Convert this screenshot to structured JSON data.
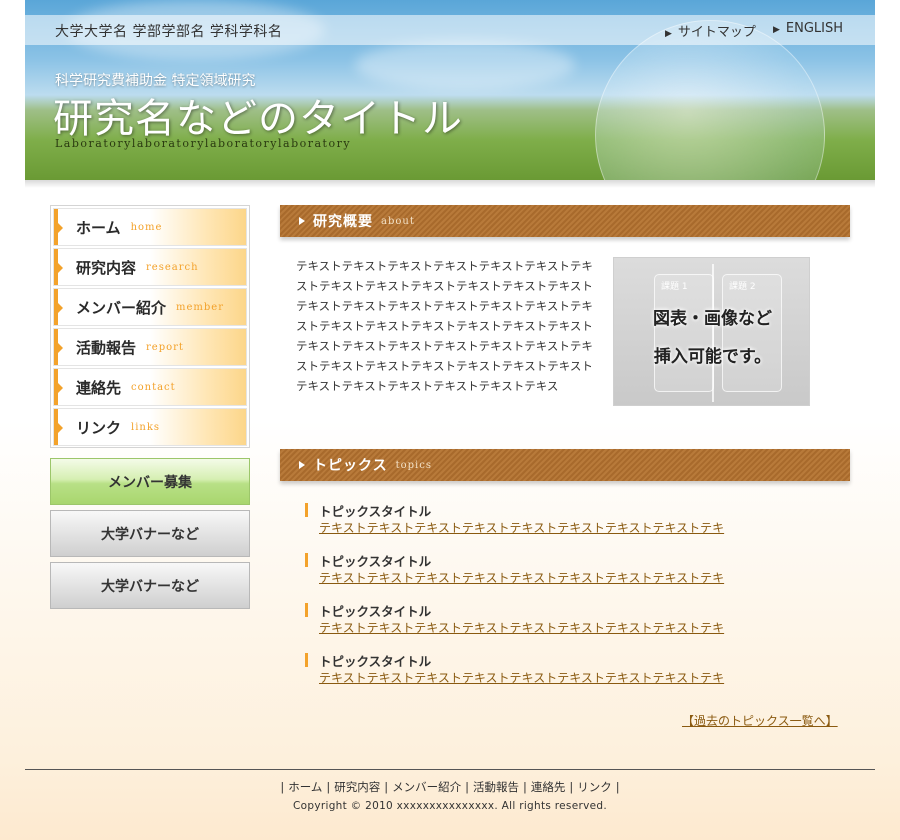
{
  "header": {
    "university": "大学大学名 学部学部名 学科学科名",
    "nav": [
      {
        "label": "サイトマップ"
      },
      {
        "label": "ENGLISH"
      }
    ],
    "subtitle": "科学研究費補助金 特定領域研究",
    "title": "研究名などのタイトル",
    "lab": "Laboratorylaboratorylaboratorylaboratory"
  },
  "sidebar": {
    "items": [
      {
        "jp": "ホーム",
        "en": "home"
      },
      {
        "jp": "研究内容",
        "en": "research"
      },
      {
        "jp": "メンバー紹介",
        "en": "member"
      },
      {
        "jp": "活動報告",
        "en": "report"
      },
      {
        "jp": "連絡先",
        "en": "contact"
      },
      {
        "jp": "リンク",
        "en": "links"
      }
    ],
    "banners": {
      "members": "メンバー募集",
      "univ1": "大学バナーなど",
      "univ2": "大学バナーなど"
    }
  },
  "about": {
    "heading_jp": "研究概要",
    "heading_en": "about",
    "text": "テキストテキストテキストテキストテキストテキストテキストテキストテキストテキストテキストテキストテキストテキストテキストテキストテキストテキストテキストテキストテキストテキストテキストテキストテキストテキストテキストテキストテキストテキストテキストテキストテキストテキストテキストテキストテキストテキストテキストテキストテキストテキストテキストテキストテキス",
    "figure": {
      "box1": "課題 1",
      "box2": "課題 2",
      "caption_line1": "図表・画像など",
      "caption_line2": "挿入可能です。"
    }
  },
  "topics": {
    "heading_jp": "トピックス",
    "heading_en": "topics",
    "items": [
      {
        "title": "トピックスタイトル",
        "link": "テキストテキストテキストテキストテキストテキストテキストテキストテキ"
      },
      {
        "title": "トピックスタイトル",
        "link": "テキストテキストテキストテキストテキストテキストテキストテキストテキ"
      },
      {
        "title": "トピックスタイトル",
        "link": "テキストテキストテキストテキストテキストテキストテキストテキストテキ"
      },
      {
        "title": "トピックスタイトル",
        "link": "テキストテキストテキストテキストテキストテキストテキストテキストテキ"
      }
    ],
    "past_link": "【過去のトピックス一覧へ】"
  },
  "footer": {
    "nav": [
      "ホーム",
      "研究内容",
      "メンバー紹介",
      "活動報告",
      "連絡先",
      "リンク"
    ],
    "copyright": "Copyright © 2010 xxxxxxxxxxxxxxx. All rights reserved."
  },
  "colors": {
    "accent_orange": "#f3a22b",
    "section_brown": "#a86a2c",
    "link_brown": "#8a5a10"
  }
}
